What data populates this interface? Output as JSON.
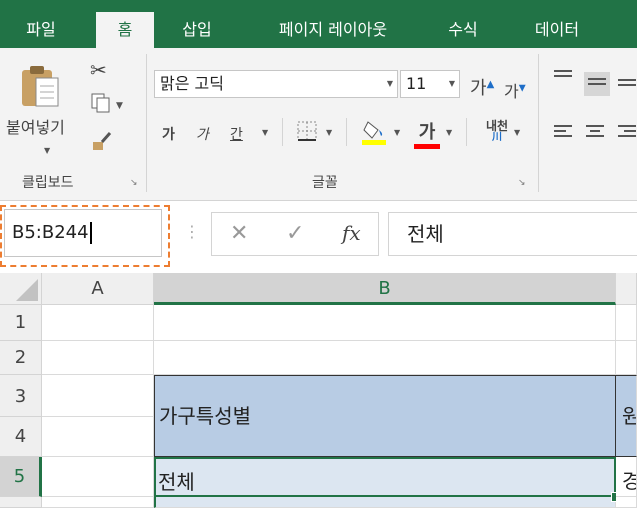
{
  "tabs": [
    "파일",
    "홈",
    "삽입",
    "페이지 레이아웃",
    "수식",
    "데이터"
  ],
  "active_tab": "홈",
  "ribbon": {
    "clipboard": {
      "paste_label": "붙여넣기",
      "group_label": "클립보드"
    },
    "font": {
      "font_name": "맑은 고딕",
      "font_size": "11",
      "grow_label": "가",
      "shrink_label": "가",
      "bold_label": "가",
      "italic_label": "가",
      "underline_label": "간",
      "font_color_label": "가",
      "phonetic_label": "내천",
      "group_label": "글꼴",
      "highlight_color": "#ffff00",
      "font_color": "#ff0000"
    }
  },
  "formula_bar": {
    "name_box": "B5:B244",
    "fx_label": "fx",
    "formula": "전체"
  },
  "grid": {
    "columns": [
      "A",
      "B"
    ],
    "rows": [
      "1",
      "2",
      "3",
      "4",
      "5"
    ],
    "cells": {
      "B3": "가구특성별",
      "C3": "원",
      "B5": "전체",
      "C5": "경"
    },
    "selection": "B5:B244"
  },
  "colors": {
    "accent": "#217346",
    "header_fill": "#b8cce4",
    "selection_fill": "#dce6f1",
    "highlight_border": "#ed7d31"
  }
}
